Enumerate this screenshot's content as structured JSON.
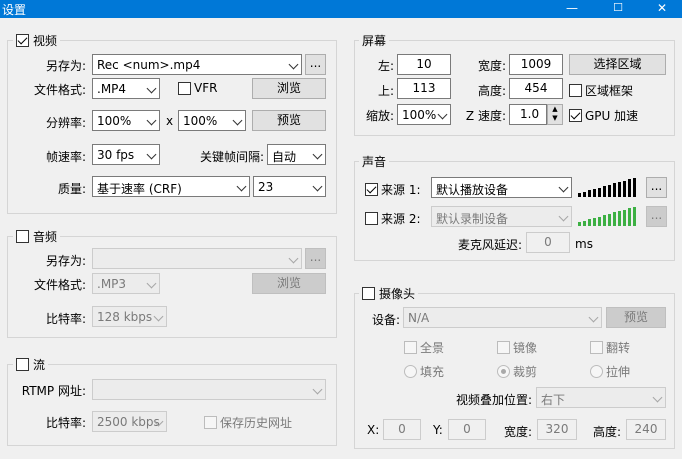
{
  "window": {
    "title": "设置",
    "minimize": "—",
    "maximize": "☐",
    "close": "✕"
  },
  "video": {
    "title": "视频",
    "enabled": true,
    "save_as_label": "另存为:",
    "save_as_value": "Rec <num>.mp4",
    "ellipsis": "...",
    "format_label": "文件格式:",
    "format_value": ".MP4",
    "vfr_label": "VFR",
    "vfr_checked": false,
    "browse": "浏览",
    "resolution_label": "分辨率:",
    "res_w": "100%",
    "x_label": "x",
    "res_h": "100%",
    "preview": "预览",
    "framerate_label": "帧速率:",
    "framerate_value": "30 fps",
    "keyframe_label": "关键帧间隔:",
    "keyframe_value": "自动",
    "quality_label": "质量:",
    "quality_mode": "基于速率 (CRF)",
    "quality_value": "23"
  },
  "audio": {
    "title": "音频",
    "enabled": false,
    "save_as_label": "另存为:",
    "save_as_value": "",
    "ellipsis": "...",
    "format_label": "文件格式:",
    "format_value": ".MP3",
    "browse": "浏览",
    "bitrate_label": "比特率:",
    "bitrate_value": "128 kbps"
  },
  "stream": {
    "title": "流",
    "enabled": false,
    "rtmp_label": "RTMP 网址:",
    "rtmp_value": "",
    "bitrate_label": "比特率:",
    "bitrate_value": "2500 kbps",
    "history_label": "保存历史网址"
  },
  "screen": {
    "title": "屏幕",
    "left_label": "左:",
    "left_value": "10",
    "width_label": "宽度:",
    "width_value": "1009",
    "select_region": "选择区域",
    "top_label": "上:",
    "top_value": "113",
    "height_label": "高度:",
    "height_value": "454",
    "region_frame_label": "区域框架",
    "region_frame_checked": false,
    "zoom_label": "缩放:",
    "zoom_value": "100%",
    "zspeed_label": "Z 速度:",
    "zspeed_value": "1.0",
    "gpu_label": "GPU 加速",
    "gpu_checked": true
  },
  "sound": {
    "title": "声音",
    "source1_label": "来源 1:",
    "source1_checked": true,
    "source1_value": "默认播放设备",
    "source2_label": "来源 2:",
    "source2_checked": false,
    "source2_value": "默认录制设备",
    "ellipsis": "...",
    "mic_delay_label": "麦克风延迟:",
    "mic_delay_value": "0",
    "mic_delay_unit": "ms",
    "meter_colors": {
      "active": "#000000",
      "green": "#3cb043",
      "empty": "#c8c8c8"
    }
  },
  "camera": {
    "title": "摄像头",
    "enabled": false,
    "device_label": "设备:",
    "device_value": "N/A",
    "preview": "预览",
    "fullscreen": "全景",
    "mirror": "镜像",
    "flip": "翻转",
    "fill": "填充",
    "crop": "裁剪",
    "stretch": "拉伸",
    "overlay_label": "视频叠加位置:",
    "overlay_value": "右下",
    "x_label": "X:",
    "x_value": "0",
    "y_label": "Y:",
    "y_value": "0",
    "w_label": "宽度:",
    "w_value": "320",
    "h_label": "高度:",
    "h_value": "240"
  }
}
